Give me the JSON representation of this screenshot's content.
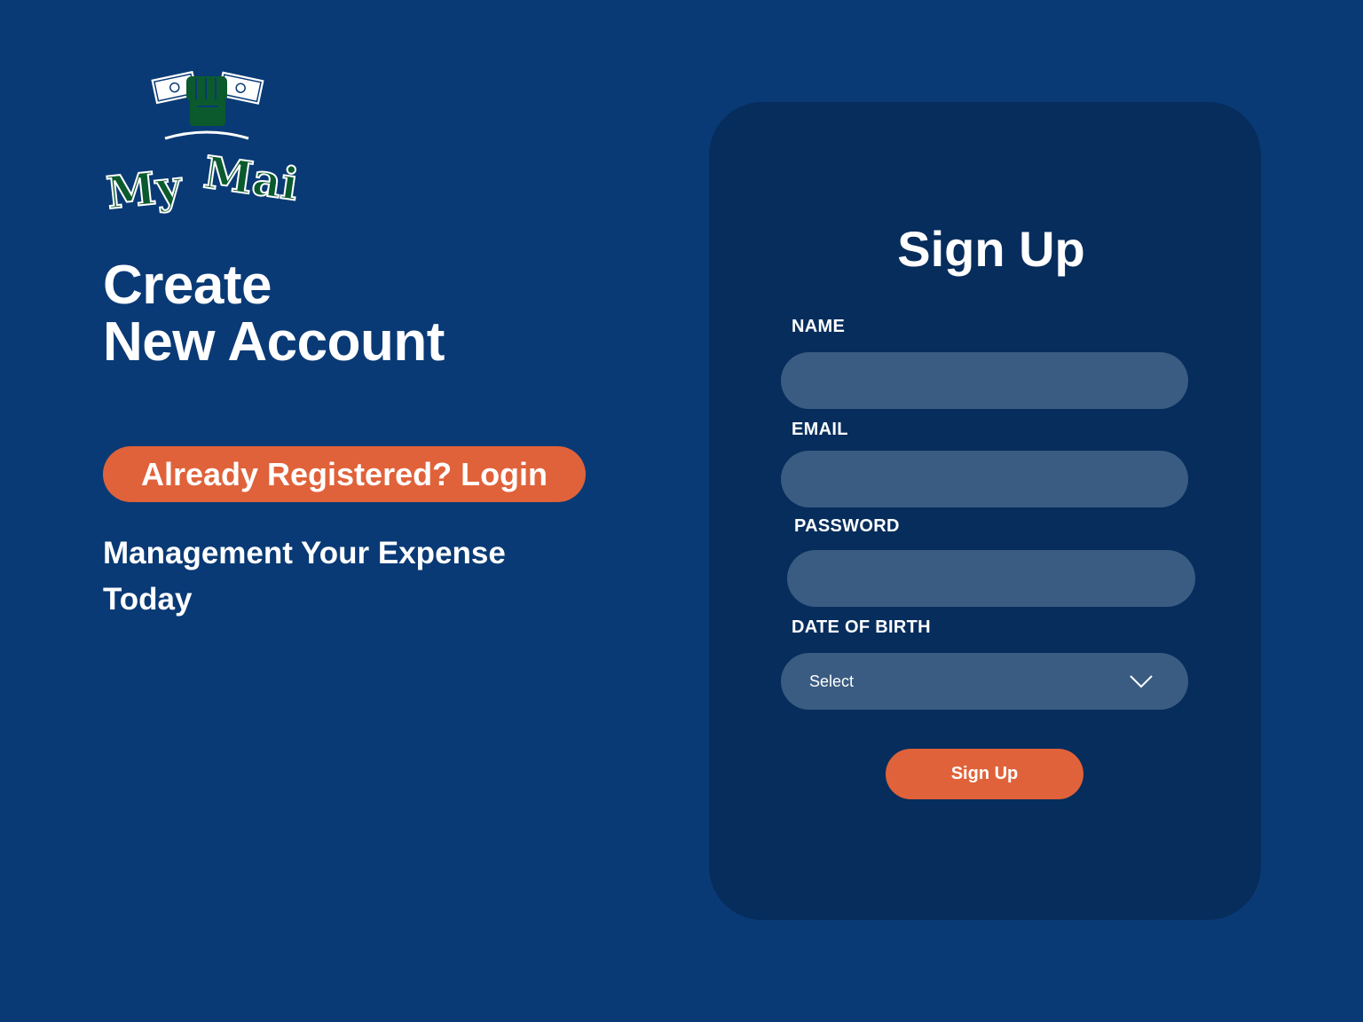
{
  "brand": {
    "logo_text": "My Mai"
  },
  "hero": {
    "title_line1": "Create",
    "title_line2": "New Account",
    "login_button": "Already Registered? Login",
    "tagline": "Management Your Expense Today"
  },
  "form": {
    "title": "Sign Up",
    "fields": [
      {
        "label": "NAME",
        "value": ""
      },
      {
        "label": "EMAIL",
        "value": ""
      },
      {
        "label": "PASSWORD",
        "value": ""
      }
    ],
    "dob": {
      "label": "DATE OF BIRTH",
      "selected": "Select"
    },
    "submit_label": "Sign Up"
  },
  "colors": {
    "background": "#093a75",
    "card": "#062d5c",
    "input": "#3a5c82",
    "accent": "#e0623a",
    "logo_green": "#0b5a2e"
  },
  "icons": {
    "logo": "money-fist-logo",
    "dropdown": "chevron-down-icon"
  }
}
